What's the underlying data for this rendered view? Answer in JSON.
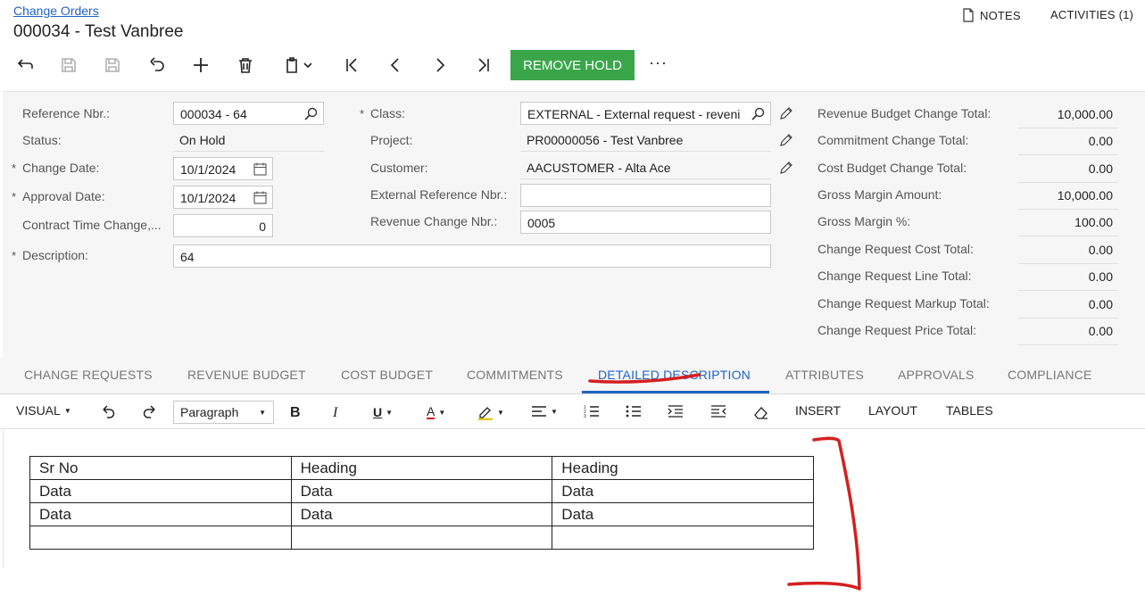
{
  "breadcrumb": "Change Orders",
  "title": "000034 - Test Vanbree",
  "header_links": {
    "notes": "NOTES",
    "activities": "ACTIVITIES (1)"
  },
  "toolbar": {
    "remove_hold": "REMOVE HOLD",
    "more": "···"
  },
  "form": {
    "reference_nbr": {
      "label": "Reference Nbr.:",
      "value": "000034 - 64"
    },
    "status": {
      "label": "Status:",
      "value": "On Hold"
    },
    "change_date": {
      "label": "Change Date:",
      "value": "10/1/2024"
    },
    "approval_date": {
      "label": "Approval Date:",
      "value": "10/1/2024"
    },
    "contract_time_change": {
      "label": "Contract Time Change,...",
      "value": "0"
    },
    "description": {
      "label": "Description:",
      "value": "64"
    },
    "class": {
      "label": "Class:",
      "value": "EXTERNAL - External request - reveni"
    },
    "project": {
      "label": "Project:",
      "value": "PR00000056 - Test Vanbree"
    },
    "customer": {
      "label": "Customer:",
      "value": "AACUSTOMER - Alta Ace"
    },
    "external_ref": {
      "label": "External Reference Nbr.:",
      "value": ""
    },
    "revenue_change": {
      "label": "Revenue Change Nbr.:",
      "value": "0005"
    }
  },
  "totals": [
    {
      "label": "Revenue Budget Change Total:",
      "value": "10,000.00"
    },
    {
      "label": "Commitment Change Total:",
      "value": "0.00"
    },
    {
      "label": "Cost Budget Change Total:",
      "value": "0.00"
    },
    {
      "label": "Gross Margin Amount:",
      "value": "10,000.00"
    },
    {
      "label": "Gross Margin %:",
      "value": "100.00"
    },
    {
      "label": "Change Request Cost Total:",
      "value": "0.00"
    },
    {
      "label": "Change Request Line Total:",
      "value": "0.00"
    },
    {
      "label": "Change Request Markup Total:",
      "value": "0.00"
    },
    {
      "label": "Change Request Price Total:",
      "value": "0.00"
    }
  ],
  "tabs": [
    "CHANGE REQUESTS",
    "REVENUE BUDGET",
    "COST BUDGET",
    "COMMITMENTS",
    "DETAILED DESCRIPTION",
    "ATTRIBUTES",
    "APPROVALS",
    "COMPLIANCE"
  ],
  "editor": {
    "visual": "VISUAL",
    "paragraph": "Paragraph",
    "bold": "B",
    "italic": "I",
    "underline": "U",
    "font_color": "A",
    "insert": "INSERT",
    "layout": "LAYOUT",
    "tables": "TABLES"
  },
  "table": [
    [
      "Sr No",
      "Heading",
      "Heading"
    ],
    [
      "Data",
      "Data",
      "Data"
    ],
    [
      "Data",
      "Data",
      "Data"
    ],
    [
      "",
      "",
      ""
    ]
  ],
  "colors": {
    "accent": "#1f63c6",
    "hold_button": "#3aa64a",
    "annotation": "#d42020"
  }
}
